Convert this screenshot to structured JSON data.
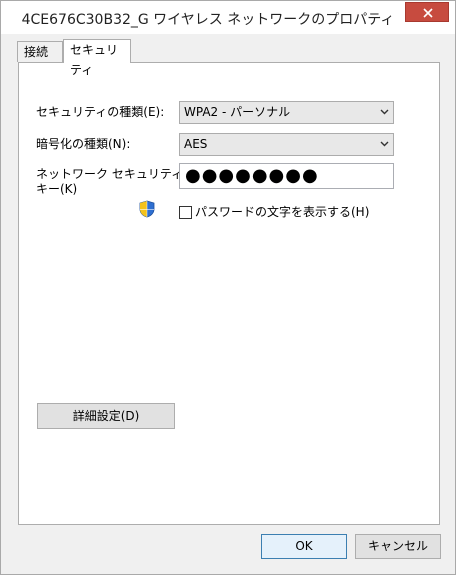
{
  "window": {
    "title": "4CE676C30B32_G ワイヤレス ネットワークのプロパティ"
  },
  "tabs": [
    {
      "label": "接続"
    },
    {
      "label": "セキュリティ"
    }
  ],
  "security": {
    "security_type_label": "セキュリティの種類(E):",
    "security_type_value": "WPA2 - パーソナル",
    "encryption_type_label": "暗号化の種類(N):",
    "encryption_type_value": "AES",
    "network_key_label_line1": "ネットワーク セキュリティ",
    "network_key_label_line2": "キー(K)",
    "network_key_value": "●●●●●●●●",
    "show_chars_label": "パスワードの文字を表示する(H)",
    "show_chars_checked": false,
    "advanced_button": "詳細設定(D)"
  },
  "footer": {
    "ok_label": "OK",
    "cancel_label": "キャンセル"
  },
  "icons": {
    "shield": "uac-shield-icon",
    "close": "close-icon",
    "dropdown_arrow": "chevron-down-icon"
  },
  "colors": {
    "close_button": "#c74b3f",
    "default_button_border": "#3c7fb1"
  }
}
